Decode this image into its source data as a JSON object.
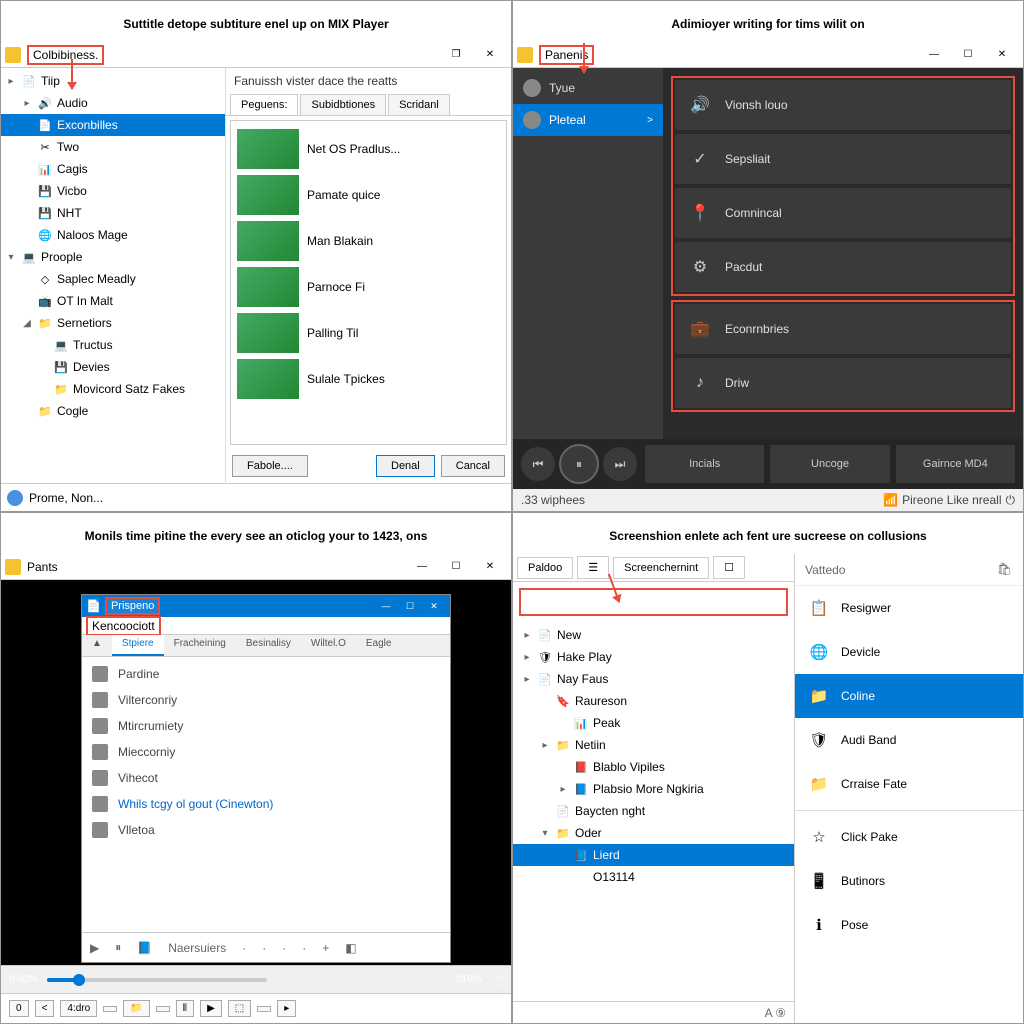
{
  "q1": {
    "caption": "Suttitle detope subtiture enel up on MIX Player",
    "title": "Colbibiness.",
    "tree": [
      {
        "exp": "▸",
        "icon": "📄",
        "label": "Tiip",
        "indent": 0
      },
      {
        "exp": "▸",
        "icon": "🔊",
        "label": "Audio",
        "indent": 1
      },
      {
        "exp": "",
        "icon": "📄",
        "label": "Exconbilles",
        "indent": 1,
        "sel": true
      },
      {
        "exp": "",
        "icon": "✂",
        "label": "Two",
        "indent": 1
      },
      {
        "exp": "",
        "icon": "📊",
        "label": "Cagis",
        "indent": 1
      },
      {
        "exp": "",
        "icon": "💾",
        "label": "Vicbo",
        "indent": 1
      },
      {
        "exp": "",
        "icon": "💾",
        "label": "NHT",
        "indent": 1
      },
      {
        "exp": "",
        "icon": "🌐",
        "label": "Naloos Mage",
        "indent": 1
      },
      {
        "exp": "▾",
        "icon": "💻",
        "label": "Proople",
        "indent": 0
      },
      {
        "exp": "",
        "icon": "◇",
        "label": "Saplec Meadly",
        "indent": 1
      },
      {
        "exp": "",
        "icon": "📺",
        "label": "OT In Malt",
        "indent": 1
      },
      {
        "exp": "◢",
        "icon": "📁",
        "label": "Sernetiors",
        "indent": 1
      },
      {
        "exp": "",
        "icon": "💻",
        "label": "Tructus",
        "indent": 2
      },
      {
        "exp": "",
        "icon": "💾",
        "label": "Devies",
        "indent": 2
      },
      {
        "exp": "",
        "icon": "📁",
        "label": "Movicord Satz Fakes",
        "indent": 2
      },
      {
        "exp": "",
        "icon": "📁",
        "label": "Cogle",
        "indent": 1
      }
    ],
    "header": "Fanuissh vister dace the reatts",
    "tabs": [
      "Peguens:",
      "Subidbtiones",
      "Scridanl"
    ],
    "items": [
      "Net OS Pradlus...",
      "Pamate quice",
      "Man Blakain",
      "Parnoce Fi",
      "Palling Til",
      "Sulale Tpickes"
    ],
    "fabole": "Fabole....",
    "denal": "Denal",
    "cancel": "Cancal",
    "status": "Prome, Non..."
  },
  "q2": {
    "caption": "Adimioyer writing for tims wilit on",
    "title": "Panenis",
    "side": [
      {
        "icon": "📁",
        "label": "Tyue"
      },
      {
        "icon": "▶",
        "label": "Pleteal",
        "act": true,
        "chev": ">"
      }
    ],
    "menu1": [
      {
        "icon": "🔊",
        "label": "Vionsh louo"
      },
      {
        "icon": "✓",
        "label": "Sepsliait"
      },
      {
        "icon": "📍",
        "label": "Comnincal"
      },
      {
        "icon": "⚙",
        "label": "Pacdut"
      }
    ],
    "menu2": [
      {
        "icon": "💼",
        "label": "Econrnbries"
      },
      {
        "icon": "♪",
        "label": "Driw"
      }
    ],
    "ctrl": [
      "Incials",
      "Uncoge",
      "Gairnce MD4"
    ],
    "status_left": ".33 wiphees",
    "status_right": "Pireone Like nreall"
  },
  "q3": {
    "caption": "Monils time pitine the every see an oticlog your to 1423, ons",
    "title": "Pants",
    "inner_title": "Prispeno",
    "inner_sub": "Kencoociott",
    "tabs": [
      "▲",
      "Stpiere",
      "Fracheining",
      "Besinalisy",
      "Wiltel.O",
      "Eagle"
    ],
    "rows": [
      {
        "icon": true,
        "label": "Pardine"
      },
      {
        "icon": true,
        "label": "Vilterconriy"
      },
      {
        "icon": true,
        "label": "Mtircrumiety"
      },
      {
        "icon": true,
        "label": "Mieccorniy"
      },
      {
        "icon": true,
        "label": "Vihecot"
      },
      {
        "icon": true,
        "label": "Whils tcgy ol gout (Cinewton)",
        "link": true
      },
      {
        "icon": true,
        "label": "Vlletoa"
      }
    ],
    "bbar_items": [
      "▶",
      "⏸",
      "📘",
      "Naersuiers",
      "·",
      "·",
      "·",
      "·",
      "+",
      "◧"
    ],
    "pct_left": "0:00%",
    "pct_right": "016%",
    "bottom": [
      "0",
      "<",
      "4:dro",
      "",
      "📁",
      "",
      "⦀",
      "▶",
      "⬚",
      "",
      "▸"
    ]
  },
  "q4": {
    "caption": "Screenshion enlete ach fent ure sucreese on collusions",
    "ltabs": [
      "Paldoo",
      "☰",
      "Screenchernint",
      "☐"
    ],
    "tree": [
      {
        "exp": "▸",
        "icon": "📄",
        "label": "New",
        "indent": 0
      },
      {
        "exp": "▸",
        "icon": "🛡",
        "label": "Hake Play",
        "indent": 0
      },
      {
        "exp": "▸",
        "icon": "📄",
        "label": "Nay Faus",
        "indent": 0
      },
      {
        "exp": "",
        "icon": "🔖",
        "label": "Raureson",
        "indent": 1
      },
      {
        "exp": "",
        "icon": "📊",
        "label": "Peak",
        "indent": 2
      },
      {
        "exp": "▸",
        "icon": "📁",
        "label": "Netiin",
        "indent": 1
      },
      {
        "exp": "",
        "icon": "📕",
        "label": "Blablo Vipiles",
        "indent": 2
      },
      {
        "exp": "▸",
        "icon": "📘",
        "label": "Plabsio More Ngkiria",
        "indent": 2
      },
      {
        "exp": "",
        "icon": "📄",
        "label": "Baycten nght",
        "indent": 1
      },
      {
        "exp": "▾",
        "icon": "📁",
        "label": "Oder",
        "indent": 1
      },
      {
        "exp": "",
        "icon": "📘",
        "label": "Lierd",
        "indent": 2,
        "sel": true
      },
      {
        "exp": "",
        "icon": "",
        "label": "O13114",
        "indent": 2
      }
    ],
    "bbar": "A  ⑨",
    "rhead": "Vattedo",
    "rlist": [
      {
        "icon": "📋",
        "label": "Resigwer"
      },
      {
        "icon": "🌐",
        "label": "Devicle"
      },
      {
        "icon": "📁",
        "label": "Coline",
        "sel": true
      },
      {
        "icon": "🛡",
        "label": "Audi Band"
      },
      {
        "icon": "📁",
        "label": "Crraise Fate"
      },
      {
        "sep": true
      },
      {
        "icon": "☆",
        "label": "Click Pake"
      },
      {
        "icon": "📱",
        "label": "Butinors"
      },
      {
        "icon": "ℹ",
        "label": "Pose"
      }
    ]
  }
}
